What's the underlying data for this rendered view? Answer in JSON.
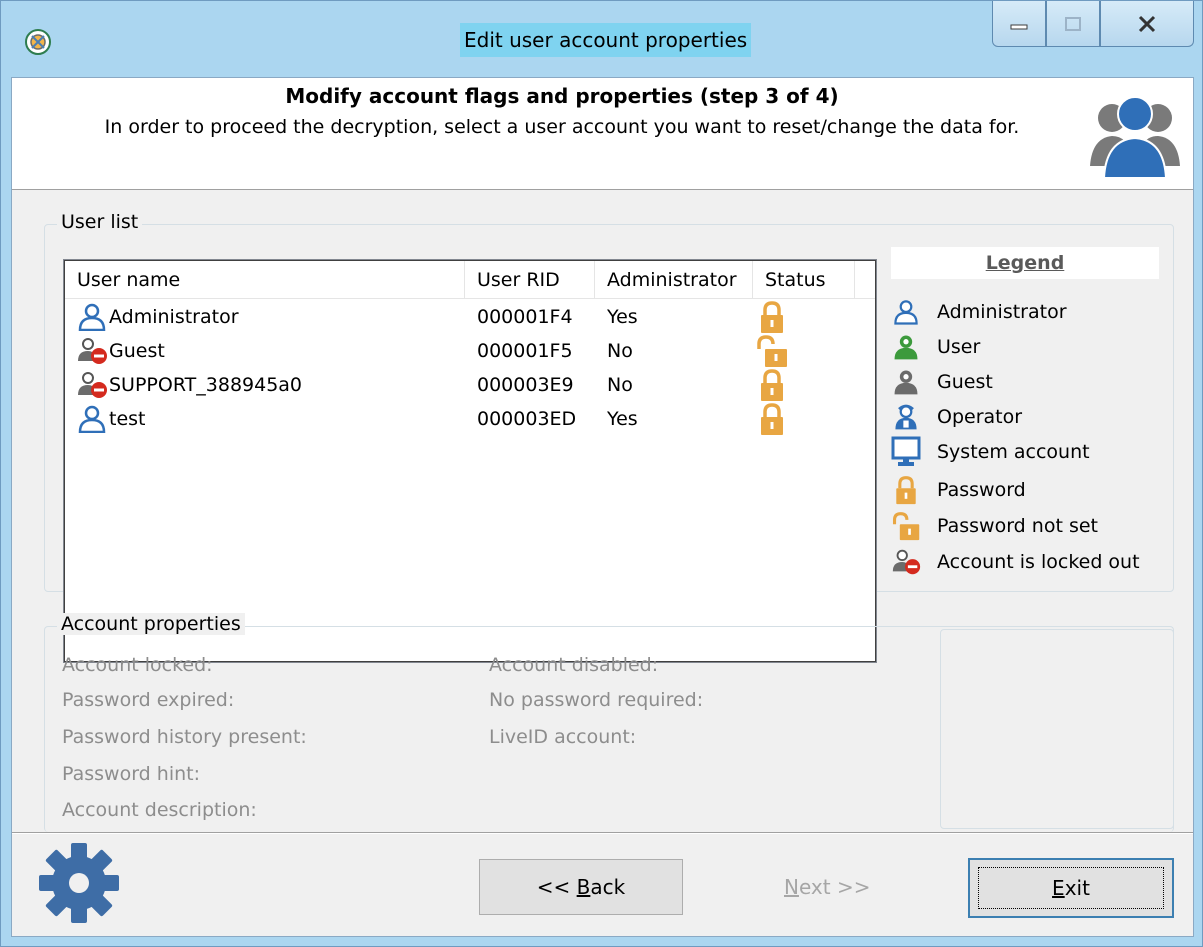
{
  "window": {
    "title": "Edit user account properties",
    "icons": {
      "app": "wizard-icon",
      "minimize": "minimize-icon",
      "maximize": "maximize-icon",
      "close": "close-icon"
    }
  },
  "header": {
    "title": "Modify account flags and properties (step 3 of 4)",
    "subtitle": "In order to proceed the decryption, select a user account you want to reset/change the data for.",
    "icon": "users-group-icon"
  },
  "user_list": {
    "label": "User list",
    "columns": [
      "User name",
      "User RID",
      "Administrator",
      "Status"
    ],
    "rows": [
      {
        "name": "Administrator",
        "rid": "000001F4",
        "admin": "Yes",
        "type_icon": "administrator-icon",
        "status_icon": "password-lock-icon"
      },
      {
        "name": "Guest",
        "rid": "000001F5",
        "admin": "No",
        "type_icon": "locked-out-icon",
        "status_icon": "password-not-set-icon"
      },
      {
        "name": "SUPPORT_388945a0",
        "rid": "000003E9",
        "admin": "No",
        "type_icon": "locked-out-icon",
        "status_icon": "password-lock-icon"
      },
      {
        "name": "test",
        "rid": "000003ED",
        "admin": "Yes",
        "type_icon": "administrator-icon",
        "status_icon": "password-lock-icon"
      }
    ]
  },
  "legend": {
    "title": "Legend",
    "items": [
      {
        "label": "Administrator",
        "icon": "administrator-icon"
      },
      {
        "label": "User",
        "icon": "user-icon"
      },
      {
        "label": "Guest",
        "icon": "guest-icon"
      },
      {
        "label": "Operator",
        "icon": "operator-icon"
      },
      {
        "label": "System account",
        "icon": "system-account-icon"
      },
      {
        "label": "Password",
        "icon": "password-lock-icon"
      },
      {
        "label": "Password not set",
        "icon": "password-not-set-icon"
      },
      {
        "label": "Account is locked out",
        "icon": "locked-out-icon"
      }
    ]
  },
  "account_properties": {
    "label": "Account properties",
    "left": [
      "Account locked:",
      "Password expired:",
      "Password history present:",
      "Password hint:",
      "Account description:"
    ],
    "right": [
      "Account disabled:",
      "No password required:",
      "LiveID account:"
    ]
  },
  "footer": {
    "back_prefix": "<< ",
    "back_accel": "B",
    "back_rest": "ack",
    "next_accel": "N",
    "next_rest": "ext >>",
    "exit_accel": "E",
    "exit_rest": "xit",
    "icon": "gear-icon"
  },
  "colors": {
    "admin_blue": "#2f6fb8",
    "user_green": "#3c9a3c",
    "guest_gray": "#6b6b6b",
    "lock_orange": "#e8a642",
    "locked_red": "#d42a1e",
    "gear_blue": "#3e6da6"
  }
}
